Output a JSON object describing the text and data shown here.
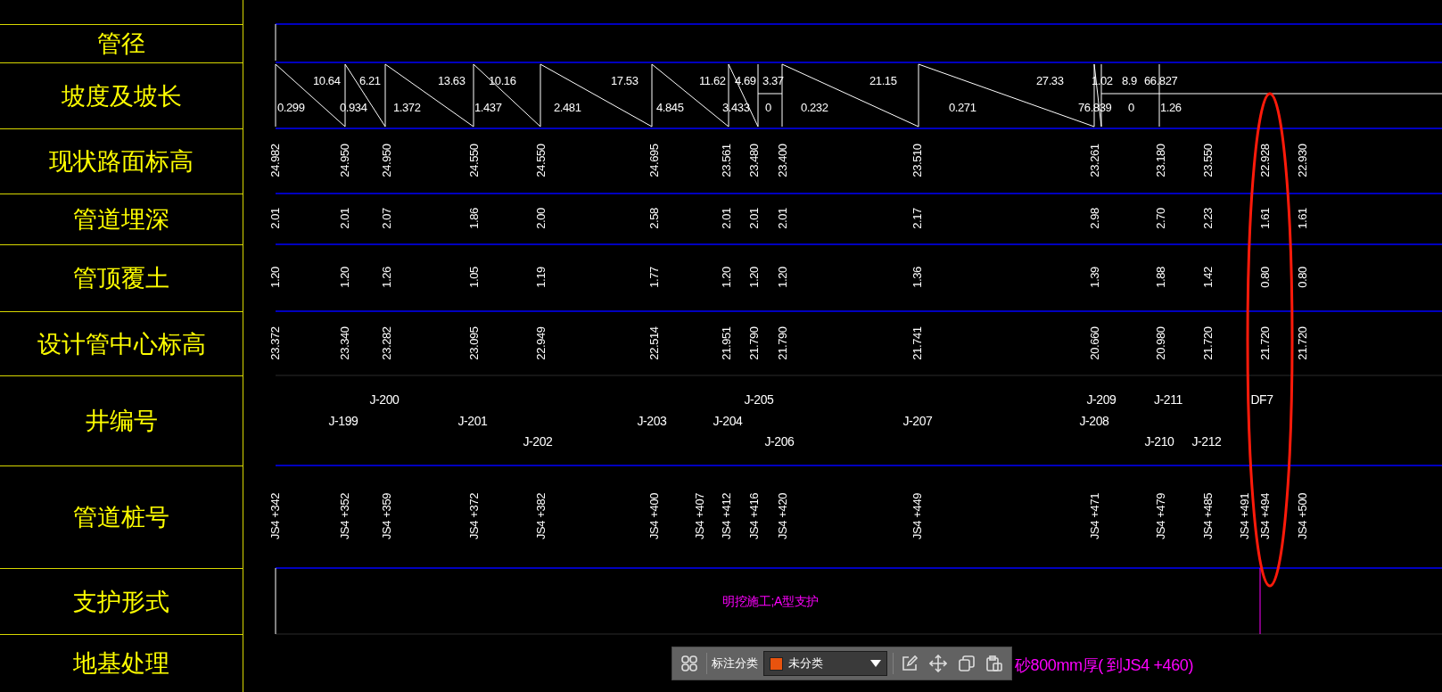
{
  "row_headers": [
    "管径",
    "坡度及坡长",
    "现状路面标高",
    "管道埋深",
    "管顶覆土",
    "设计管中心标高",
    "井编号",
    "管道桩号",
    "支护形式",
    "地基处理"
  ],
  "slope_segments": [
    {
      "length": "10.64",
      "slope": "0.299",
      "kind": "sloped"
    },
    {
      "length": "6.21",
      "slope": "0.934",
      "kind": "sloped"
    },
    {
      "length": "13.63",
      "slope": "1.372",
      "kind": "sloped"
    },
    {
      "length": "10.16",
      "slope": "1.437",
      "kind": "sloped"
    },
    {
      "length": "17.53",
      "slope": "2.481",
      "kind": "sloped"
    },
    {
      "length": "11.62",
      "slope": "4.845",
      "kind": "sloped"
    },
    {
      "length": "4.69",
      "slope": "3.433",
      "kind": "sloped"
    },
    {
      "length": "3.37",
      "slope": "0",
      "kind": "flat"
    },
    {
      "length": "21.15",
      "slope": "0.232",
      "kind": "sloped"
    },
    {
      "length": "27.33",
      "slope": "0.271",
      "kind": "sloped"
    },
    {
      "length": "1.02",
      "slope": "76.839",
      "kind": "sloped"
    },
    {
      "length": "8.9",
      "slope": "0",
      "kind": "flat"
    },
    {
      "length": "66.827",
      "slope": "1.26",
      "kind": "flat"
    }
  ],
  "stations": [
    {
      "ground_elevation": "24.982",
      "pipe_depth": "2.01",
      "cover_depth": "1.20",
      "design_elevation": "23.372",
      "station": "JS4 +342"
    },
    {
      "ground_elevation": "24.950",
      "pipe_depth": "2.01",
      "cover_depth": "1.20",
      "design_elevation": "23.340",
      "station": "JS4 +352"
    },
    {
      "ground_elevation": "24.950",
      "pipe_depth": "2.07",
      "cover_depth": "1.26",
      "design_elevation": "23.282",
      "station": "JS4 +359"
    },
    {
      "ground_elevation": "24.550",
      "pipe_depth": "1.86",
      "cover_depth": "1.05",
      "design_elevation": "23.095",
      "station": "JS4 +372"
    },
    {
      "ground_elevation": "24.550",
      "pipe_depth": "2.00",
      "cover_depth": "1.19",
      "design_elevation": "22.949",
      "station": "JS4 +382"
    },
    {
      "ground_elevation": "24.695",
      "pipe_depth": "2.58",
      "cover_depth": "1.77",
      "design_elevation": "22.514",
      "station": "JS4 +400"
    },
    {
      "station": "JS4 +407"
    },
    {
      "ground_elevation": "23.561",
      "pipe_depth": "2.01",
      "cover_depth": "1.20",
      "design_elevation": "21.951",
      "station": "JS4 +412"
    },
    {
      "ground_elevation": "23.480",
      "pipe_depth": "2.01",
      "cover_depth": "1.20",
      "design_elevation": "21.790",
      "station": "JS4 +416"
    },
    {
      "ground_elevation": "23.400",
      "pipe_depth": "2.01",
      "cover_depth": "1.20",
      "design_elevation": "21.790",
      "station": "JS4 +420"
    },
    {
      "ground_elevation": "23.510",
      "pipe_depth": "2.17",
      "cover_depth": "1.36",
      "design_elevation": "21.741",
      "station": "JS4 +449"
    },
    {
      "ground_elevation": "23.261",
      "pipe_depth": "2.98",
      "cover_depth": "1.39",
      "design_elevation": "20.660",
      "station": "JS4 +471"
    },
    {
      "ground_elevation": "23.180",
      "pipe_depth": "2.70",
      "cover_depth": "1.88",
      "design_elevation": "20.980",
      "station": "JS4 +479"
    },
    {
      "ground_elevation": "23.550",
      "pipe_depth": "2.23",
      "cover_depth": "1.42",
      "design_elevation": "21.720",
      "station": "JS4 +485"
    },
    {
      "station": "JS4 +491"
    },
    {
      "ground_elevation": "22.928",
      "pipe_depth": "1.61",
      "cover_depth": "0.80",
      "design_elevation": "21.720",
      "station": "JS4 +494"
    },
    {
      "ground_elevation": "22.930",
      "pipe_depth": "1.61",
      "cover_depth": "0.80",
      "design_elevation": "21.720",
      "station": "JS4 +500"
    }
  ],
  "well_numbers": [
    "J-200",
    "J-205",
    "J-209",
    "J-211",
    "DF7",
    "J-199",
    "J-201",
    "J-203",
    "J-204",
    "J-207",
    "J-208",
    "J-202",
    "J-206",
    "J-210",
    "J-212"
  ],
  "support_row": {
    "text": "明挖施工;A型支护"
  },
  "foundation_row": {
    "text": "砂800mm厚( 到JS4 +460)"
  },
  "annotation_toolbar": {
    "label": "标注分类",
    "category": "未分类"
  }
}
